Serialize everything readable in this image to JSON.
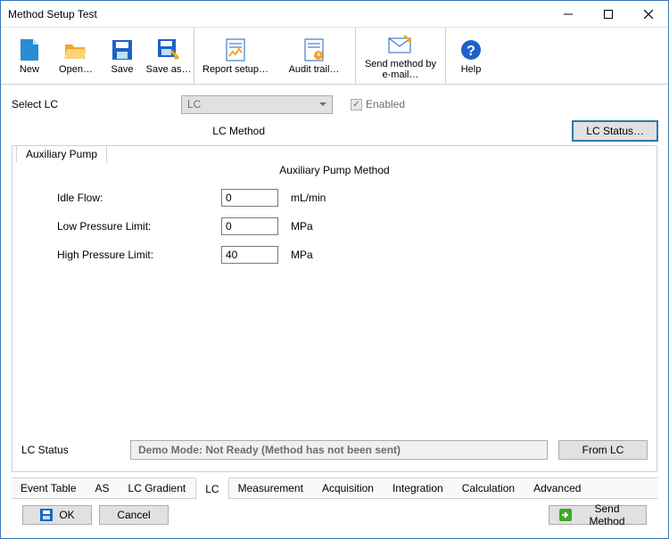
{
  "window": {
    "title": "Method Setup Test"
  },
  "toolbar": {
    "new": "New",
    "open": "Open…",
    "save": "Save",
    "saveas": "Save as…",
    "report": "Report setup…",
    "audit": "Audit trail…",
    "sendmail": "Send method by\ne-mail…",
    "help": "Help"
  },
  "selectrow": {
    "label": "Select LC",
    "combo_value": "LC",
    "enabled_label": "Enabled",
    "enabled_checked": true
  },
  "method": {
    "title": "LC Method",
    "status_btn": "LC Status…"
  },
  "aux": {
    "tab_label": "Auxiliary Pump",
    "panel_title": "Auxiliary Pump Method",
    "fields": {
      "idle_flow": {
        "label": "Idle Flow:",
        "value": "0",
        "unit": "mL/min"
      },
      "low_press": {
        "label": "Low Pressure Limit:",
        "value": "0",
        "unit": "MPa"
      },
      "high_press": {
        "label": "High Pressure Limit:",
        "value": "40",
        "unit": "MPa"
      }
    }
  },
  "status": {
    "label": "LC Status",
    "text": "Demo Mode: Not Ready (Method has not been sent)",
    "from_lc": "From LC"
  },
  "tabs": [
    "Event Table",
    "AS",
    "LC Gradient",
    "LC",
    "Measurement",
    "Acquisition",
    "Integration",
    "Calculation",
    "Advanced"
  ],
  "active_tab_index": 3,
  "footer": {
    "ok": "OK",
    "cancel": "Cancel",
    "send": "Send Method"
  },
  "colors": {
    "accent_blue": "#2a7ab0",
    "toolbar_orange": "#f5a623",
    "help_blue": "#1e62c7",
    "send_green": "#3fa82b"
  }
}
